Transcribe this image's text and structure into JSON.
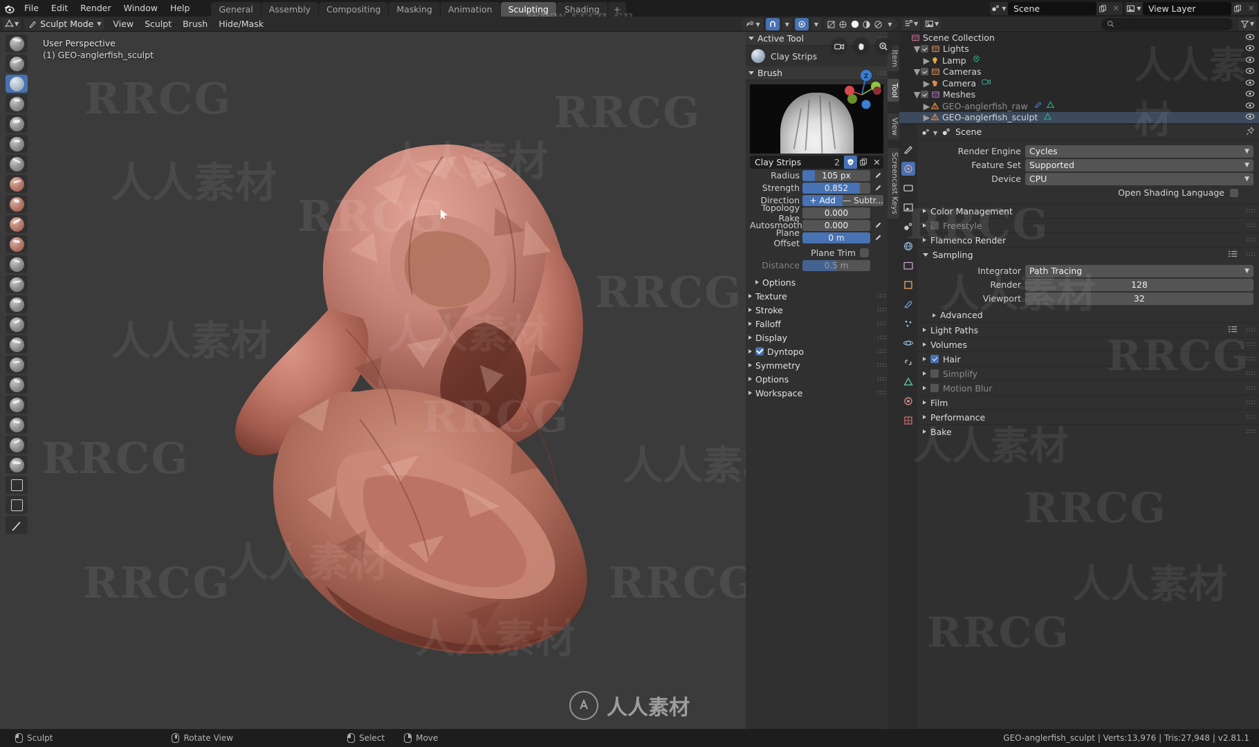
{
  "topbar": {
    "logo_icon": "blender-logo-icon",
    "menus": [
      "File",
      "Edit",
      "Render",
      "Window",
      "Help"
    ],
    "workspaces": [
      {
        "label": "General",
        "active": false
      },
      {
        "label": "Assembly",
        "active": false
      },
      {
        "label": "Compositing",
        "active": false
      },
      {
        "label": "Masking",
        "active": false
      },
      {
        "label": "Animation",
        "active": false
      },
      {
        "label": "Sculpting",
        "active": true
      },
      {
        "label": "Shading",
        "active": false
      },
      {
        "label": "+",
        "active": false
      }
    ],
    "scene_icon": "scene-icon",
    "scene_name": "Scene",
    "view_layer_icon": "view-layer-icon",
    "view_layer_name": "View Layer",
    "new_icon": "duplicate-icon",
    "close_icon": "close-icon"
  },
  "viewport_header": {
    "editor_type_icon": "editor-type-3dview-icon",
    "mode_icon": "sculpt-mode-icon",
    "mode": "Sculpt Mode",
    "menus": [
      "View",
      "Sculpt",
      "Brush",
      "Hide/Mask"
    ],
    "right_icons": [
      "visibility-icon",
      "snap-magnet-icon",
      "proportional-edit-icon",
      "overlays-icon",
      "xray-icon"
    ],
    "shading_modes": [
      "wireframe",
      "solid",
      "material-preview",
      "rendered"
    ],
    "active_shading": "solid"
  },
  "viewport": {
    "overlay_line1": "User Perspective",
    "overlay_line2": "(1) GEO-anglerfish_sculpt",
    "gizmo_buttons": [
      "camera-view-icon",
      "pan-hand-icon",
      "zoom-icon"
    ],
    "nav_axes": [
      {
        "label": "Z",
        "color": "#3b7fd4"
      },
      {
        "label": "Y",
        "color": "#8dc63f"
      },
      {
        "label": "X",
        "color": "#d9484d"
      }
    ],
    "cursor_icon": "mouse-cursor-icon"
  },
  "toolbar": {
    "tools": [
      {
        "name": "draw",
        "active": false,
        "tint": "cool"
      },
      {
        "name": "draw-sharp",
        "active": false,
        "tint": "cool"
      },
      {
        "name": "clay-strips",
        "active": true,
        "tint": "clay"
      },
      {
        "name": "clay-thumb",
        "active": false,
        "tint": "cool"
      },
      {
        "name": "layer",
        "active": false,
        "tint": "cool"
      },
      {
        "name": "inflate",
        "active": false,
        "tint": "cool"
      },
      {
        "name": "blob",
        "active": false,
        "tint": "cool"
      },
      {
        "name": "crease",
        "active": false,
        "tint": "warm"
      },
      {
        "name": "smooth",
        "active": false,
        "tint": "warm"
      },
      {
        "name": "flatten",
        "active": false,
        "tint": "warm"
      },
      {
        "name": "fill",
        "active": false,
        "tint": "warm"
      },
      {
        "name": "scrape",
        "active": false,
        "tint": "cool"
      },
      {
        "name": "pinch",
        "active": false,
        "tint": "cool"
      },
      {
        "name": "grab",
        "active": false,
        "tint": "cool"
      },
      {
        "name": "elastic-deform",
        "active": false,
        "tint": "cool"
      },
      {
        "name": "snake-hook",
        "active": false,
        "tint": "cool"
      },
      {
        "name": "thumb",
        "active": false,
        "tint": "cool"
      },
      {
        "name": "pose",
        "active": false,
        "tint": "cool"
      },
      {
        "name": "nudge",
        "active": false,
        "tint": "cool"
      },
      {
        "name": "rotate",
        "active": false,
        "tint": "cool"
      },
      {
        "name": "simplify",
        "active": false,
        "tint": "cool"
      },
      {
        "name": "mask",
        "active": false,
        "tint": "cool"
      },
      {
        "name": "box-mask",
        "active": false,
        "tint": "flat"
      },
      {
        "name": "box-hide",
        "active": false,
        "tint": "flat"
      },
      {
        "name": "line-project",
        "active": false,
        "tint": "flat"
      }
    ]
  },
  "sidebar_tabs": [
    {
      "label": "Item",
      "active": false
    },
    {
      "label": "Tool",
      "active": true
    },
    {
      "label": "View",
      "active": false
    },
    {
      "label": "Screencast Keys",
      "active": false
    }
  ],
  "tool_panel": {
    "active_tool_section": "Active Tool",
    "active_tool_name": "Clay Strips",
    "brush_section": "Brush",
    "brush_preview_icon": "brush-preview-thumbnail",
    "brush_id_name": "Clay Strips",
    "brush_users": "2",
    "brush_fake_user_icon": "shield-icon",
    "brush_new_icon": "duplicate-icon",
    "brush_unlink_icon": "close-icon",
    "properties": [
      {
        "label": "Radius",
        "value": "105 px",
        "fill": 18,
        "anim": true
      },
      {
        "label": "Strength",
        "value": "0.852",
        "fill": 85,
        "anim": true
      },
      {
        "label": "Topology Rake",
        "value": "0.000",
        "fill": 0,
        "anim": false
      },
      {
        "label": "Autosmooth",
        "value": "0.000",
        "fill": 0,
        "anim": true
      },
      {
        "label": "Plane Offset",
        "value": "0 m",
        "fill": 100,
        "anim": true
      }
    ],
    "direction_label": "Direction",
    "direction_add": "Add",
    "direction_sub": "Subtr...",
    "plane_trim_label": "Plane Trim",
    "plane_trim_checked": false,
    "distance_label": "Distance",
    "distance_value": "0.5 m",
    "options_sub": "Options",
    "sections": [
      {
        "label": "Texture",
        "checkbox": null
      },
      {
        "label": "Stroke",
        "checkbox": null
      },
      {
        "label": "Falloff",
        "checkbox": null
      },
      {
        "label": "Display",
        "checkbox": null
      },
      {
        "label": "Dyntopo",
        "checkbox": true
      },
      {
        "label": "Symmetry",
        "checkbox": null
      },
      {
        "label": "Options",
        "checkbox": null
      },
      {
        "label": "Workspace",
        "checkbox": null
      }
    ]
  },
  "outliner": {
    "display_mode_icon": "outliner-icon",
    "filter_icon": "filter-icon",
    "search_icon": "search-icon",
    "search_placeholder": "",
    "root": "Scene Collection",
    "rows": [
      {
        "indent": 0,
        "label": "Scene Collection",
        "icon": "collection-icon",
        "icon_color": "#c06a92",
        "check": false,
        "tri": false,
        "selected": false,
        "dim": false,
        "badges": []
      },
      {
        "indent": 1,
        "label": "Lights",
        "icon": "collection-icon",
        "icon_color": "#d08a55",
        "check": true,
        "tri": "open",
        "selected": false,
        "dim": false,
        "badges": []
      },
      {
        "indent": 2,
        "label": "Lamp",
        "icon": "light-icon",
        "icon_color": "#e8a84b",
        "check": false,
        "tri": "closed",
        "selected": false,
        "dim": false,
        "badges": [
          "light-data-icon"
        ]
      },
      {
        "indent": 1,
        "label": "Cameras",
        "icon": "collection-icon",
        "icon_color": "#d08a55",
        "check": true,
        "tri": "open",
        "selected": false,
        "dim": false,
        "badges": []
      },
      {
        "indent": 2,
        "label": "Camera",
        "icon": "camera-icon",
        "icon_color": "#e08a4b",
        "check": false,
        "tri": "closed",
        "selected": false,
        "dim": false,
        "badges": [
          "camera-data-icon"
        ]
      },
      {
        "indent": 1,
        "label": "Meshes",
        "icon": "collection-icon",
        "icon_color": "#b06ac0",
        "check": true,
        "tri": "open",
        "selected": false,
        "dim": false,
        "badges": []
      },
      {
        "indent": 2,
        "label": "GEO-anglerfish_raw",
        "icon": "mesh-icon",
        "icon_color": "#e08a4b",
        "check": false,
        "tri": "closed",
        "selected": false,
        "dim": true,
        "badges": [
          "modifier-icon",
          "mesh-data-icon"
        ]
      },
      {
        "indent": 2,
        "label": "GEO-anglerfish_sculpt",
        "icon": "mesh-icon",
        "icon_color": "#e08a4b",
        "check": false,
        "tri": "closed",
        "selected": true,
        "dim": false,
        "badges": [
          "mesh-data-icon"
        ]
      }
    ],
    "eye_icon": "eye-icon"
  },
  "properties": {
    "tabs": [
      "tool-icon",
      "render-icon",
      "output-icon",
      "view-layer-icon",
      "scene-icon",
      "world-icon",
      "collection-icon",
      "object-icon",
      "modifier-icon",
      "particles-icon",
      "physics-icon",
      "constraint-icon",
      "data-icon",
      "material-icon",
      "texture-icon"
    ],
    "breadcrumb_icon": "scene-icon",
    "breadcrumb": "Scene",
    "pin_icon": "pin-icon",
    "rows": [
      {
        "label": "Render Engine",
        "value": "Cycles",
        "type": "select"
      },
      {
        "label": "Feature Set",
        "value": "Supported",
        "type": "select"
      },
      {
        "label": "Device",
        "value": "CPU",
        "type": "select"
      }
    ],
    "osl_label": "Open Shading Language",
    "osl_checked": false,
    "sections": [
      {
        "label": "Color Management",
        "open": false,
        "checkbox": null,
        "list_icon": false,
        "dim": false
      },
      {
        "label": "Freestyle",
        "open": false,
        "checkbox": false,
        "list_icon": false,
        "dim": true
      },
      {
        "label": "Flamenco Render",
        "open": false,
        "checkbox": null,
        "list_icon": false,
        "dim": false
      },
      {
        "label": "Sampling",
        "open": true,
        "checkbox": null,
        "list_icon": true,
        "dim": false
      }
    ],
    "sampling": {
      "integrator_label": "Integrator",
      "integrator_value": "Path Tracing",
      "render_label": "Render",
      "render_value": "128",
      "viewport_label": "Viewport",
      "viewport_value": "32",
      "advanced_label": "Advanced"
    },
    "sections2": [
      {
        "label": "Light Paths",
        "open": false,
        "checkbox": null,
        "list_icon": true,
        "dim": false
      },
      {
        "label": "Volumes",
        "open": false,
        "checkbox": null,
        "list_icon": false,
        "dim": false
      },
      {
        "label": "Hair",
        "open": false,
        "checkbox": true,
        "list_icon": false,
        "dim": false
      },
      {
        "label": "Simplify",
        "open": false,
        "checkbox": false,
        "list_icon": false,
        "dim": true
      },
      {
        "label": "Motion Blur",
        "open": false,
        "checkbox": false,
        "list_icon": false,
        "dim": true
      },
      {
        "label": "Film",
        "open": false,
        "checkbox": null,
        "list_icon": false,
        "dim": false
      },
      {
        "label": "Performance",
        "open": false,
        "checkbox": null,
        "list_icon": false,
        "dim": false
      },
      {
        "label": "Bake",
        "open": false,
        "checkbox": null,
        "list_icon": false,
        "dim": false
      }
    ]
  },
  "status_bar": {
    "items": [
      {
        "icon": "mouse-left-icon",
        "label": "Sculpt"
      },
      {
        "icon": "mouse-middle-icon",
        "label": "Rotate View"
      },
      {
        "icon": "mouse-left-icon",
        "label": "Select"
      },
      {
        "icon": "mouse-right-icon",
        "label": "Move"
      }
    ],
    "stats": "GEO-anglerfish_sculpt | Verts:13,976 | Tris:27,948 | v2.81.1"
  },
  "watermarks": {
    "top_url": "www.rrcg.cn",
    "brand_text": "RRCG",
    "cn_text": "人人素材",
    "bottom_text": "人人素材"
  },
  "colors": {
    "accent_blue": "#4772b3",
    "panel_bg": "#303030",
    "header_bg": "#2b2b2b",
    "viewport_bg": "#3b3b3b",
    "mesh_color": "#b8705f"
  }
}
